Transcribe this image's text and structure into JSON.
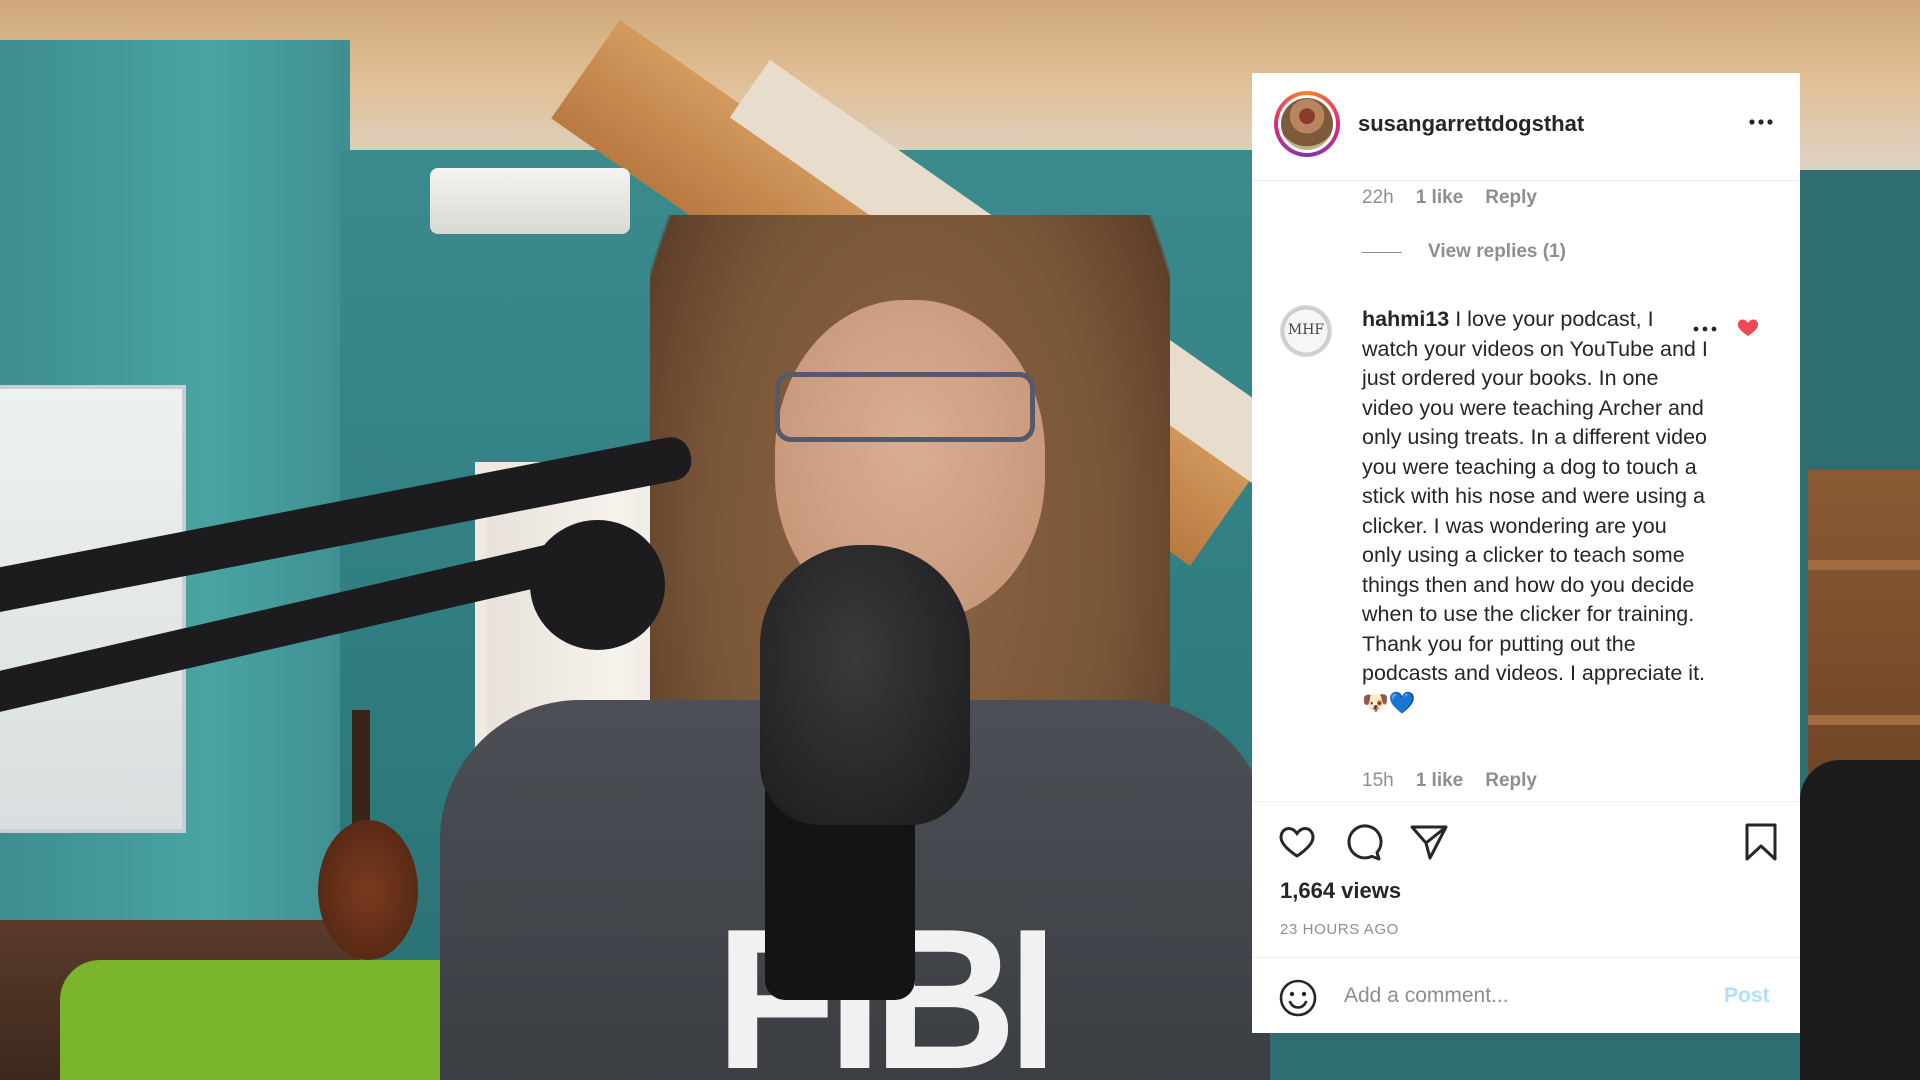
{
  "post": {
    "username": "susangarrettdogsthat",
    "previous_comment_meta": {
      "time": "22h",
      "likes": "1 like",
      "reply": "Reply"
    },
    "view_replies": "View replies (1)",
    "comment": {
      "username": "hahmi13",
      "text": "I love your podcast, I watch your videos on YouTube and I just ordered your books. In one video you were teaching Archer and only using treats. In a different video you were teaching a dog to touch a stick with his nose and were using a clicker. I was wondering are you only using a clicker to teach some things then and how do you decide when to use the clicker for training. Thank you for putting out the podcasts and videos. I appreciate it. 🐶💙",
      "time": "15h",
      "likes": "1 like",
      "reply": "Reply",
      "liked": true
    },
    "views": "1,664 views",
    "posted": "23 HOURS AGO",
    "comment_box": {
      "placeholder": "Add a comment...",
      "post_label": "Post"
    }
  },
  "icons": {
    "more": "more-options-icon",
    "heart": "heart-icon",
    "comment": "comment-icon",
    "share": "share-icon",
    "bookmark": "bookmark-icon",
    "emoji": "emoji-icon"
  },
  "colors": {
    "like_red": "#ed4956",
    "post_disabled": "#b2dffc",
    "muted_text": "#8e8e8e",
    "primary_text": "#262626"
  },
  "background": {
    "shirt_print": "FIBI"
  }
}
